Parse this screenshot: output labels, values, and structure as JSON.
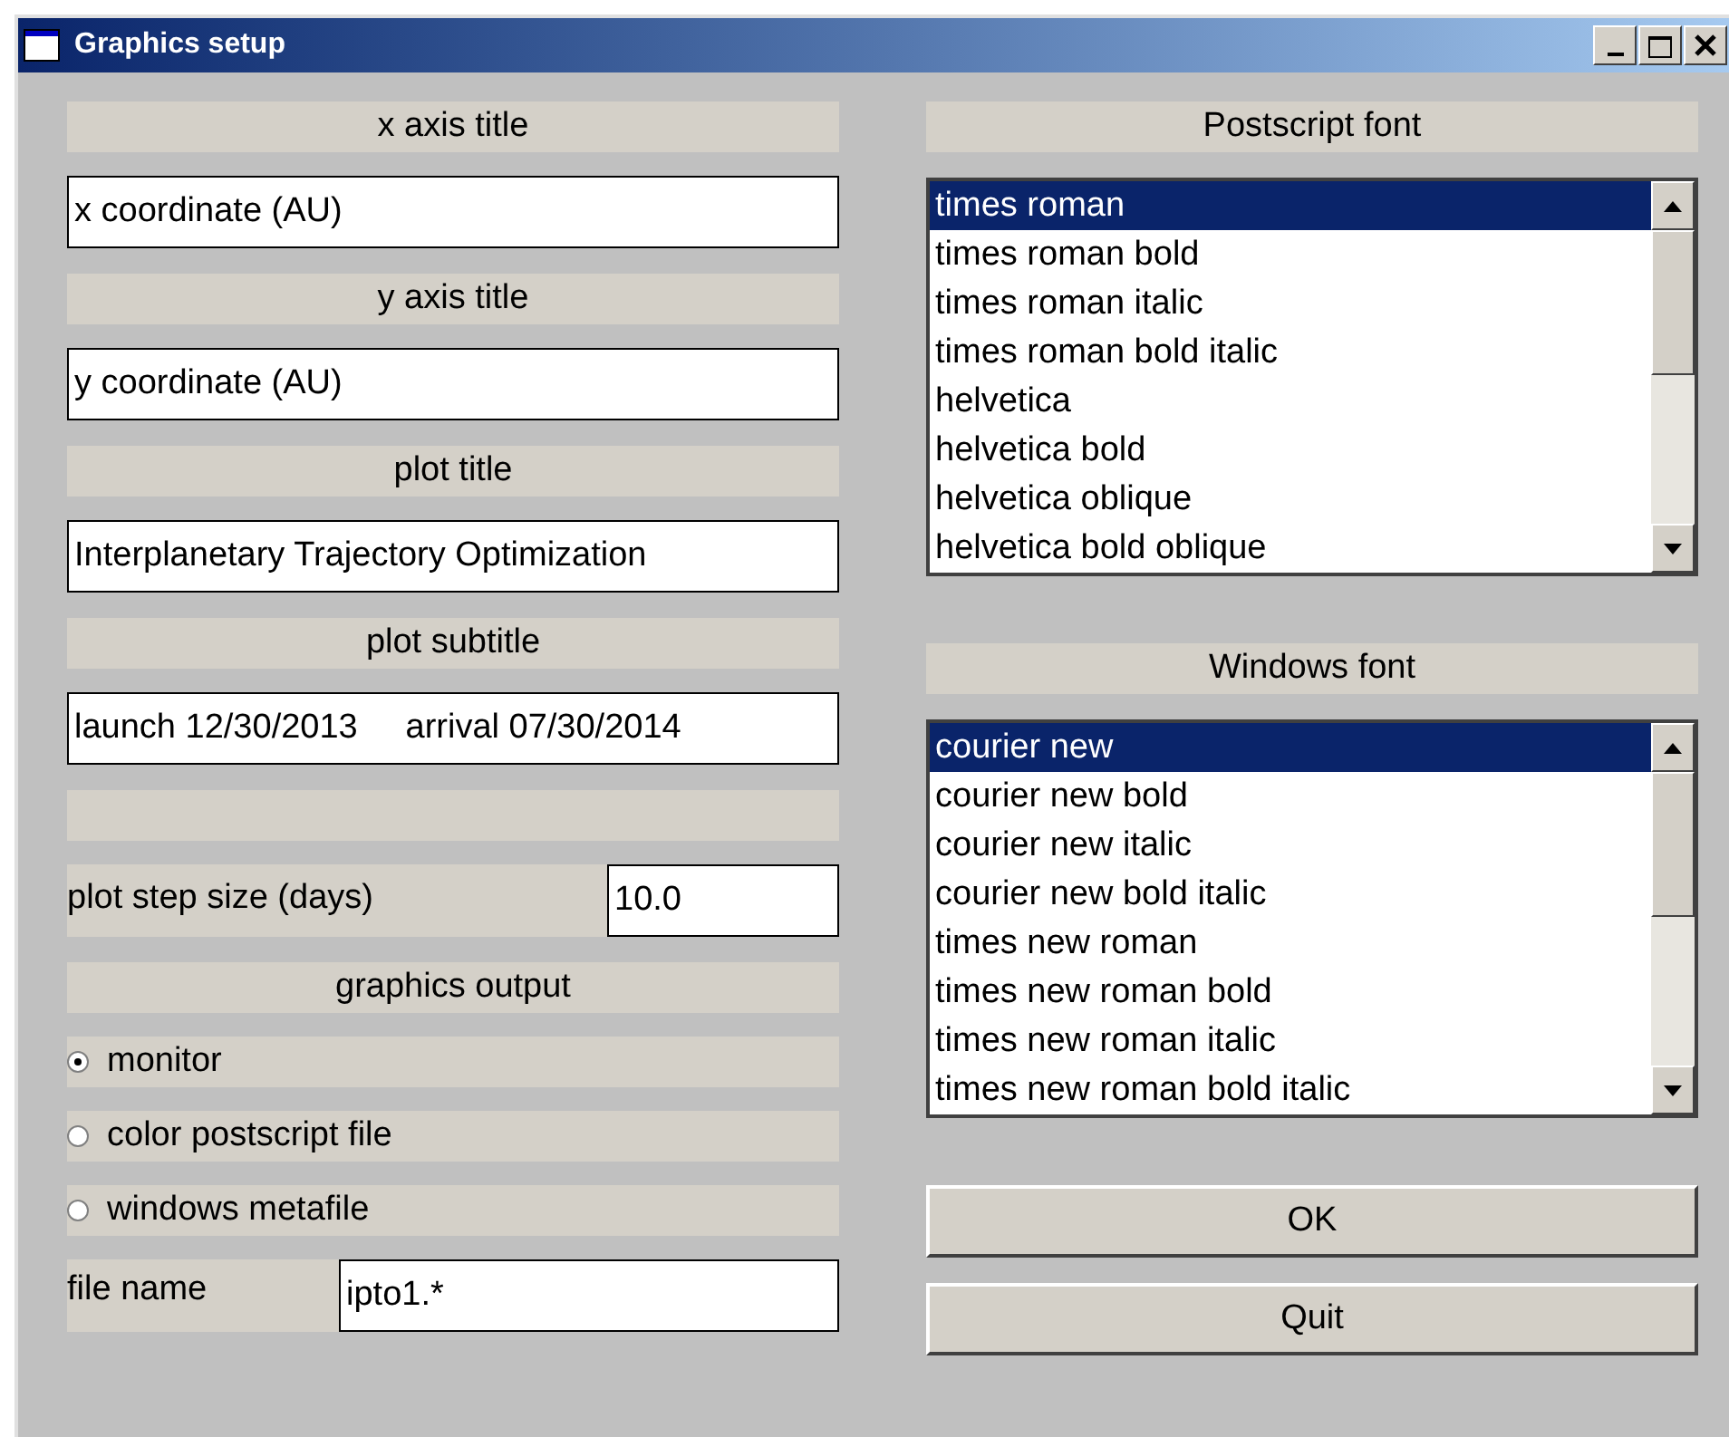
{
  "window": {
    "title": "Graphics setup"
  },
  "fields": [
    {
      "label": "x axis title",
      "value": "x coordinate (AU)"
    },
    {
      "label": "y axis title",
      "value": "y coordinate (AU)"
    },
    {
      "label": "plot title",
      "value": "Interplanetary Trajectory Optimization"
    },
    {
      "label": "plot subtitle",
      "value": "launch 12/30/2013     arrival 07/30/2014"
    }
  ],
  "step_size": {
    "label": "plot step size (days)",
    "value": "10.0"
  },
  "graphics_output": {
    "label": "graphics output",
    "options": [
      {
        "label": "monitor",
        "selected": true
      },
      {
        "label": "color postscript file",
        "selected": false
      },
      {
        "label": "windows metafile",
        "selected": false
      }
    ]
  },
  "file_name": {
    "label": "file name",
    "value": "ipto1.*"
  },
  "postscript_font": {
    "label": "Postscript font",
    "items": [
      {
        "label": "times roman",
        "selected": true
      },
      {
        "label": "times roman bold",
        "selected": false
      },
      {
        "label": "times roman italic",
        "selected": false
      },
      {
        "label": "times roman bold italic",
        "selected": false
      },
      {
        "label": "helvetica",
        "selected": false
      },
      {
        "label": "helvetica bold",
        "selected": false
      },
      {
        "label": "helvetica oblique",
        "selected": false
      },
      {
        "label": "helvetica bold oblique",
        "selected": false
      }
    ]
  },
  "windows_font": {
    "label": "Windows font",
    "items": [
      {
        "label": "courier new",
        "selected": true
      },
      {
        "label": "courier new bold",
        "selected": false
      },
      {
        "label": "courier new italic",
        "selected": false
      },
      {
        "label": "courier new bold italic",
        "selected": false
      },
      {
        "label": "times new roman",
        "selected": false
      },
      {
        "label": "times new roman bold",
        "selected": false
      },
      {
        "label": "times new roman italic",
        "selected": false
      },
      {
        "label": "times new roman bold italic",
        "selected": false
      }
    ]
  },
  "buttons": [
    "OK",
    "Quit"
  ]
}
